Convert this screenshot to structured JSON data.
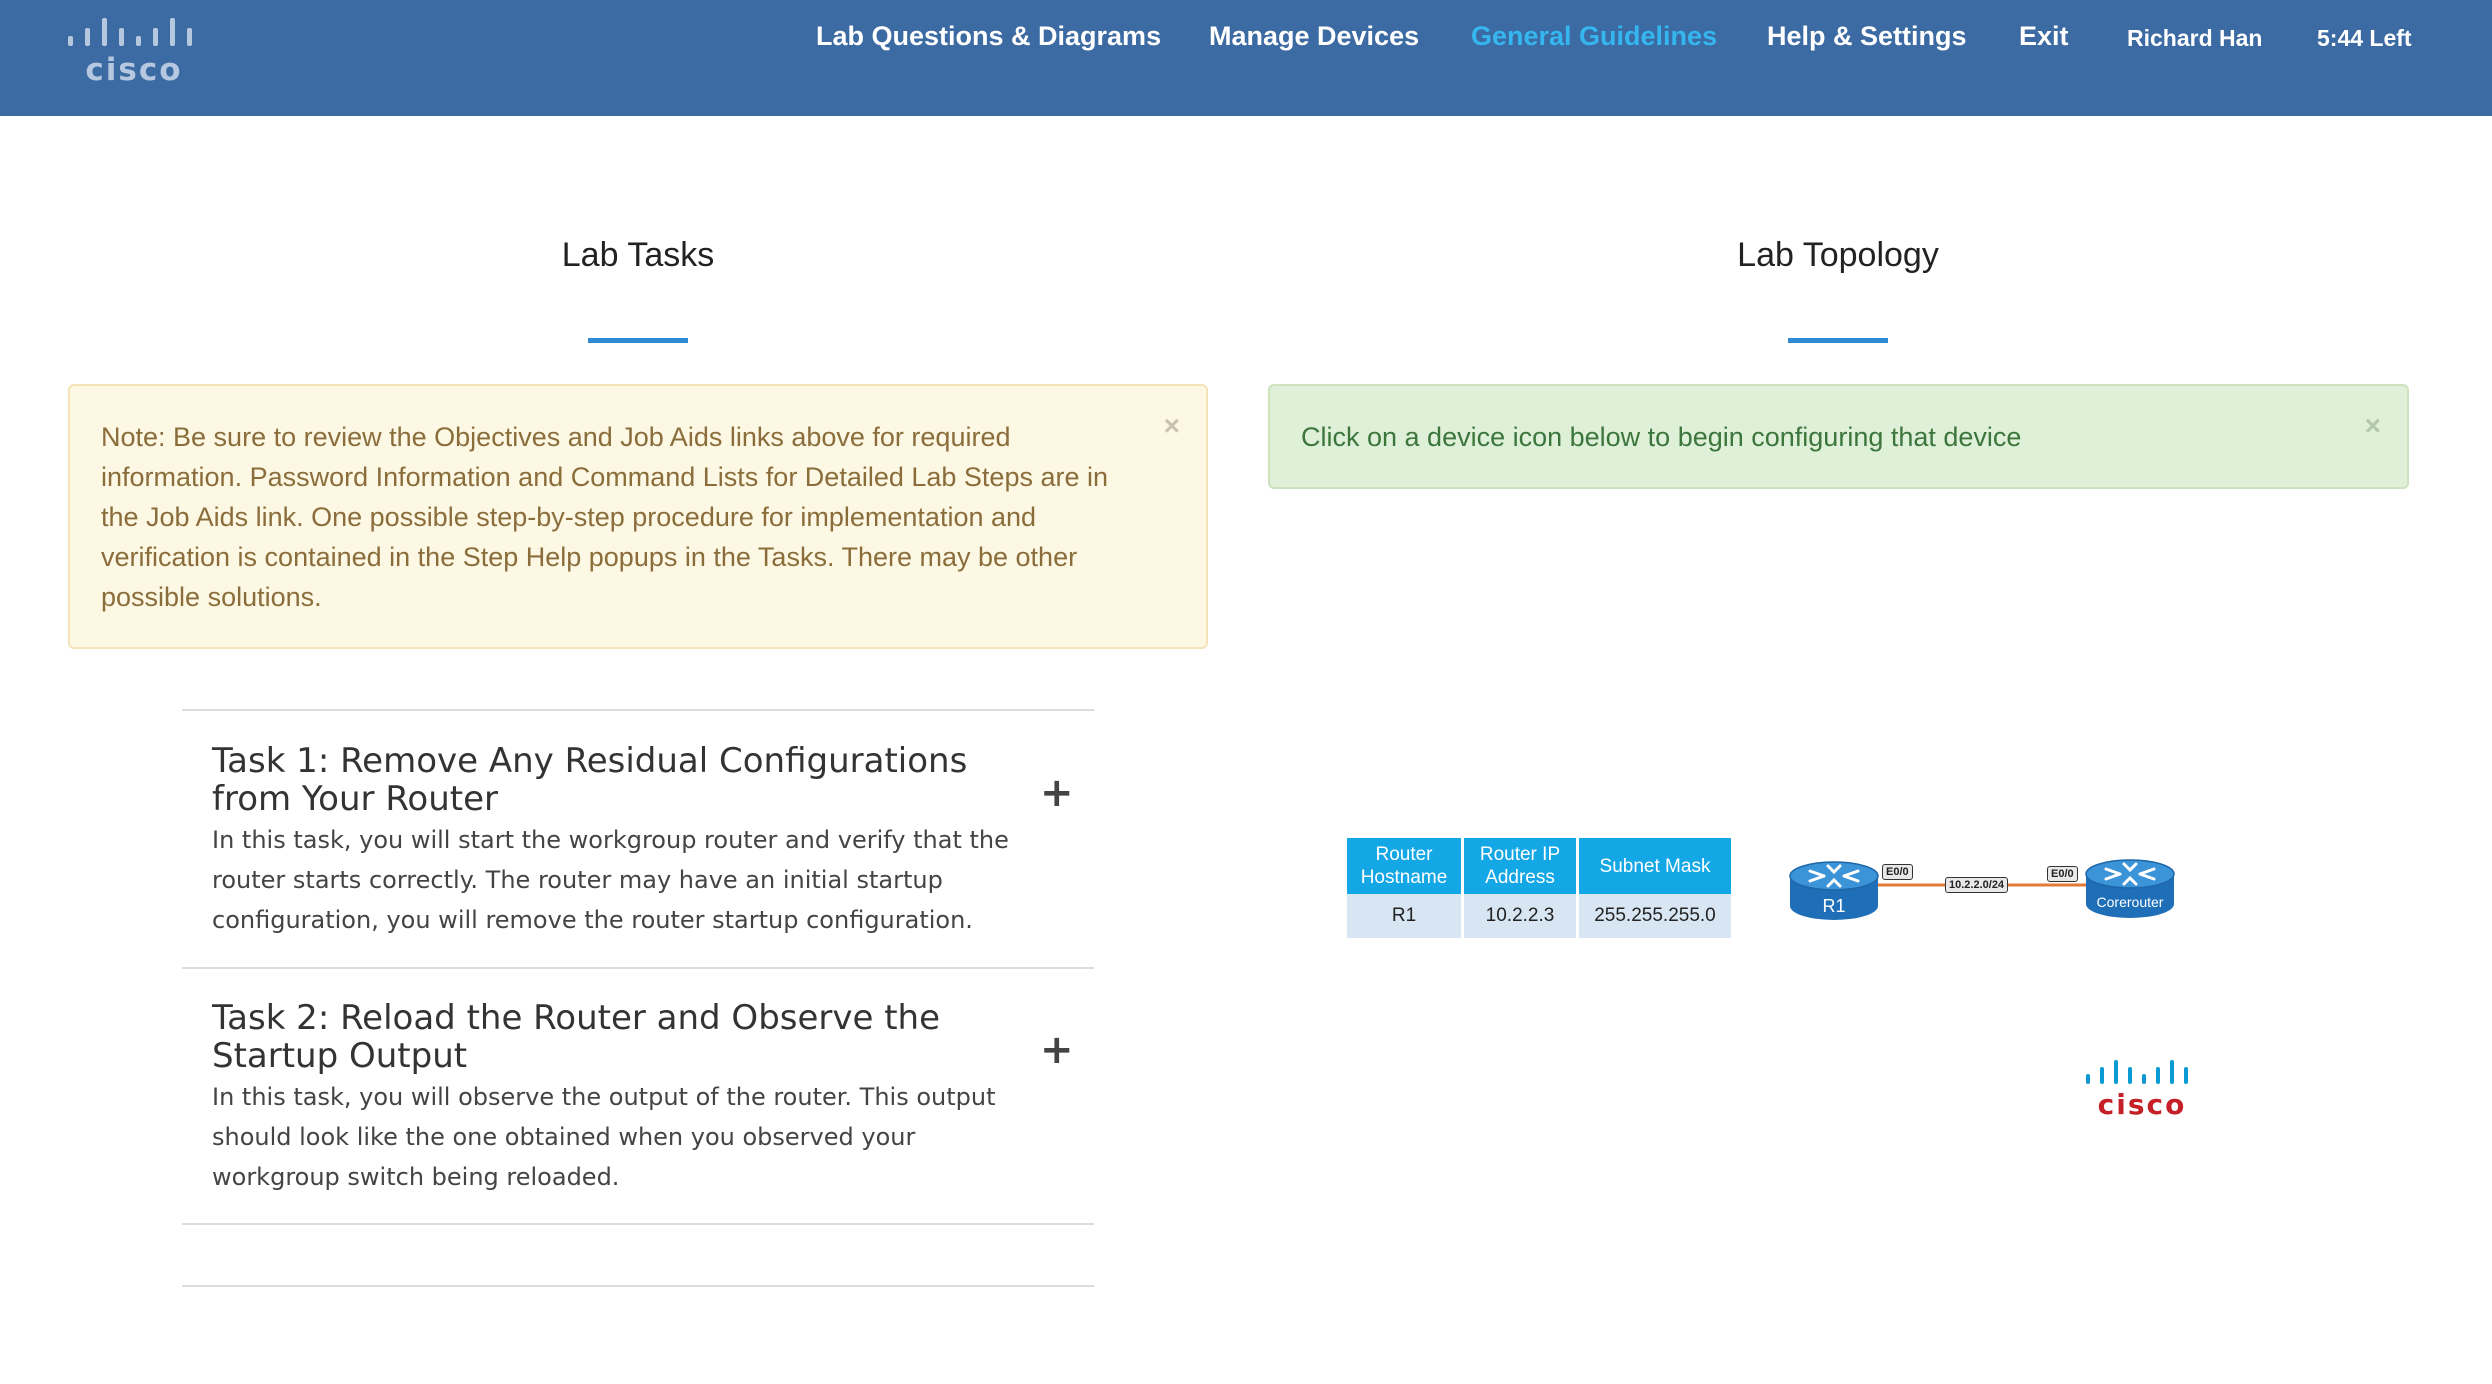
{
  "brand": {
    "logo_text": "cisco",
    "footer_logo_text": "cisco",
    "colors": {
      "navbar": "#3c6aa2",
      "active_link": "#35b6ee",
      "accent_rule": "#2f8bd6",
      "cisco_red": "#c52027"
    }
  },
  "nav": {
    "lab_questions": "Lab Questions & Diagrams",
    "manage_devices": "Manage Devices",
    "general_guidelines": "General Guidelines",
    "help_settings": "Help & Settings",
    "exit": "Exit",
    "user": "Richard Han",
    "time_left": "5:44 Left"
  },
  "lab_tasks": {
    "heading": "Lab Tasks",
    "note": "Note: Be sure to review the Objectives and Job Aids links above for required information. Password Information and Command Lists for Detailed Lab Steps are in the Job Aids link. One possible step-by-step procedure for implementation and verification is contained in the Step Help popups in the Tasks. There may be other possible solutions.",
    "close_glyph": "×",
    "tasks": [
      {
        "title": "Task 1: Remove Any Residual Configurations from Your Router",
        "description": "In this task, you will start the workgroup router and verify that the router starts correctly. The router may have an initial startup configuration, you will remove the router startup configuration.",
        "expand_glyph": "+"
      },
      {
        "title": "Task 2: Reload the Router and Observe the Startup Output",
        "description": "In this task, you will observe the output of the router. This output should look like the one obtained when you observed your workgroup switch being reloaded.",
        "expand_glyph": "+"
      }
    ]
  },
  "lab_topology": {
    "heading": "Lab Topology",
    "info": "Click on a device icon below to begin configuring that device",
    "close_glyph": "×",
    "table": {
      "headers": [
        "Router Hostname",
        "Router IP Address",
        "Subnet Mask"
      ],
      "rows": [
        [
          "R1",
          "10.2.2.3",
          "255.255.255.0"
        ]
      ]
    },
    "diagram": {
      "left_router": "R1",
      "right_router": "Corerouter",
      "left_interface": "E0/0",
      "right_interface": "E0/0",
      "link_subnet": "10.2.2.0/24",
      "icon": "router-icon"
    }
  }
}
